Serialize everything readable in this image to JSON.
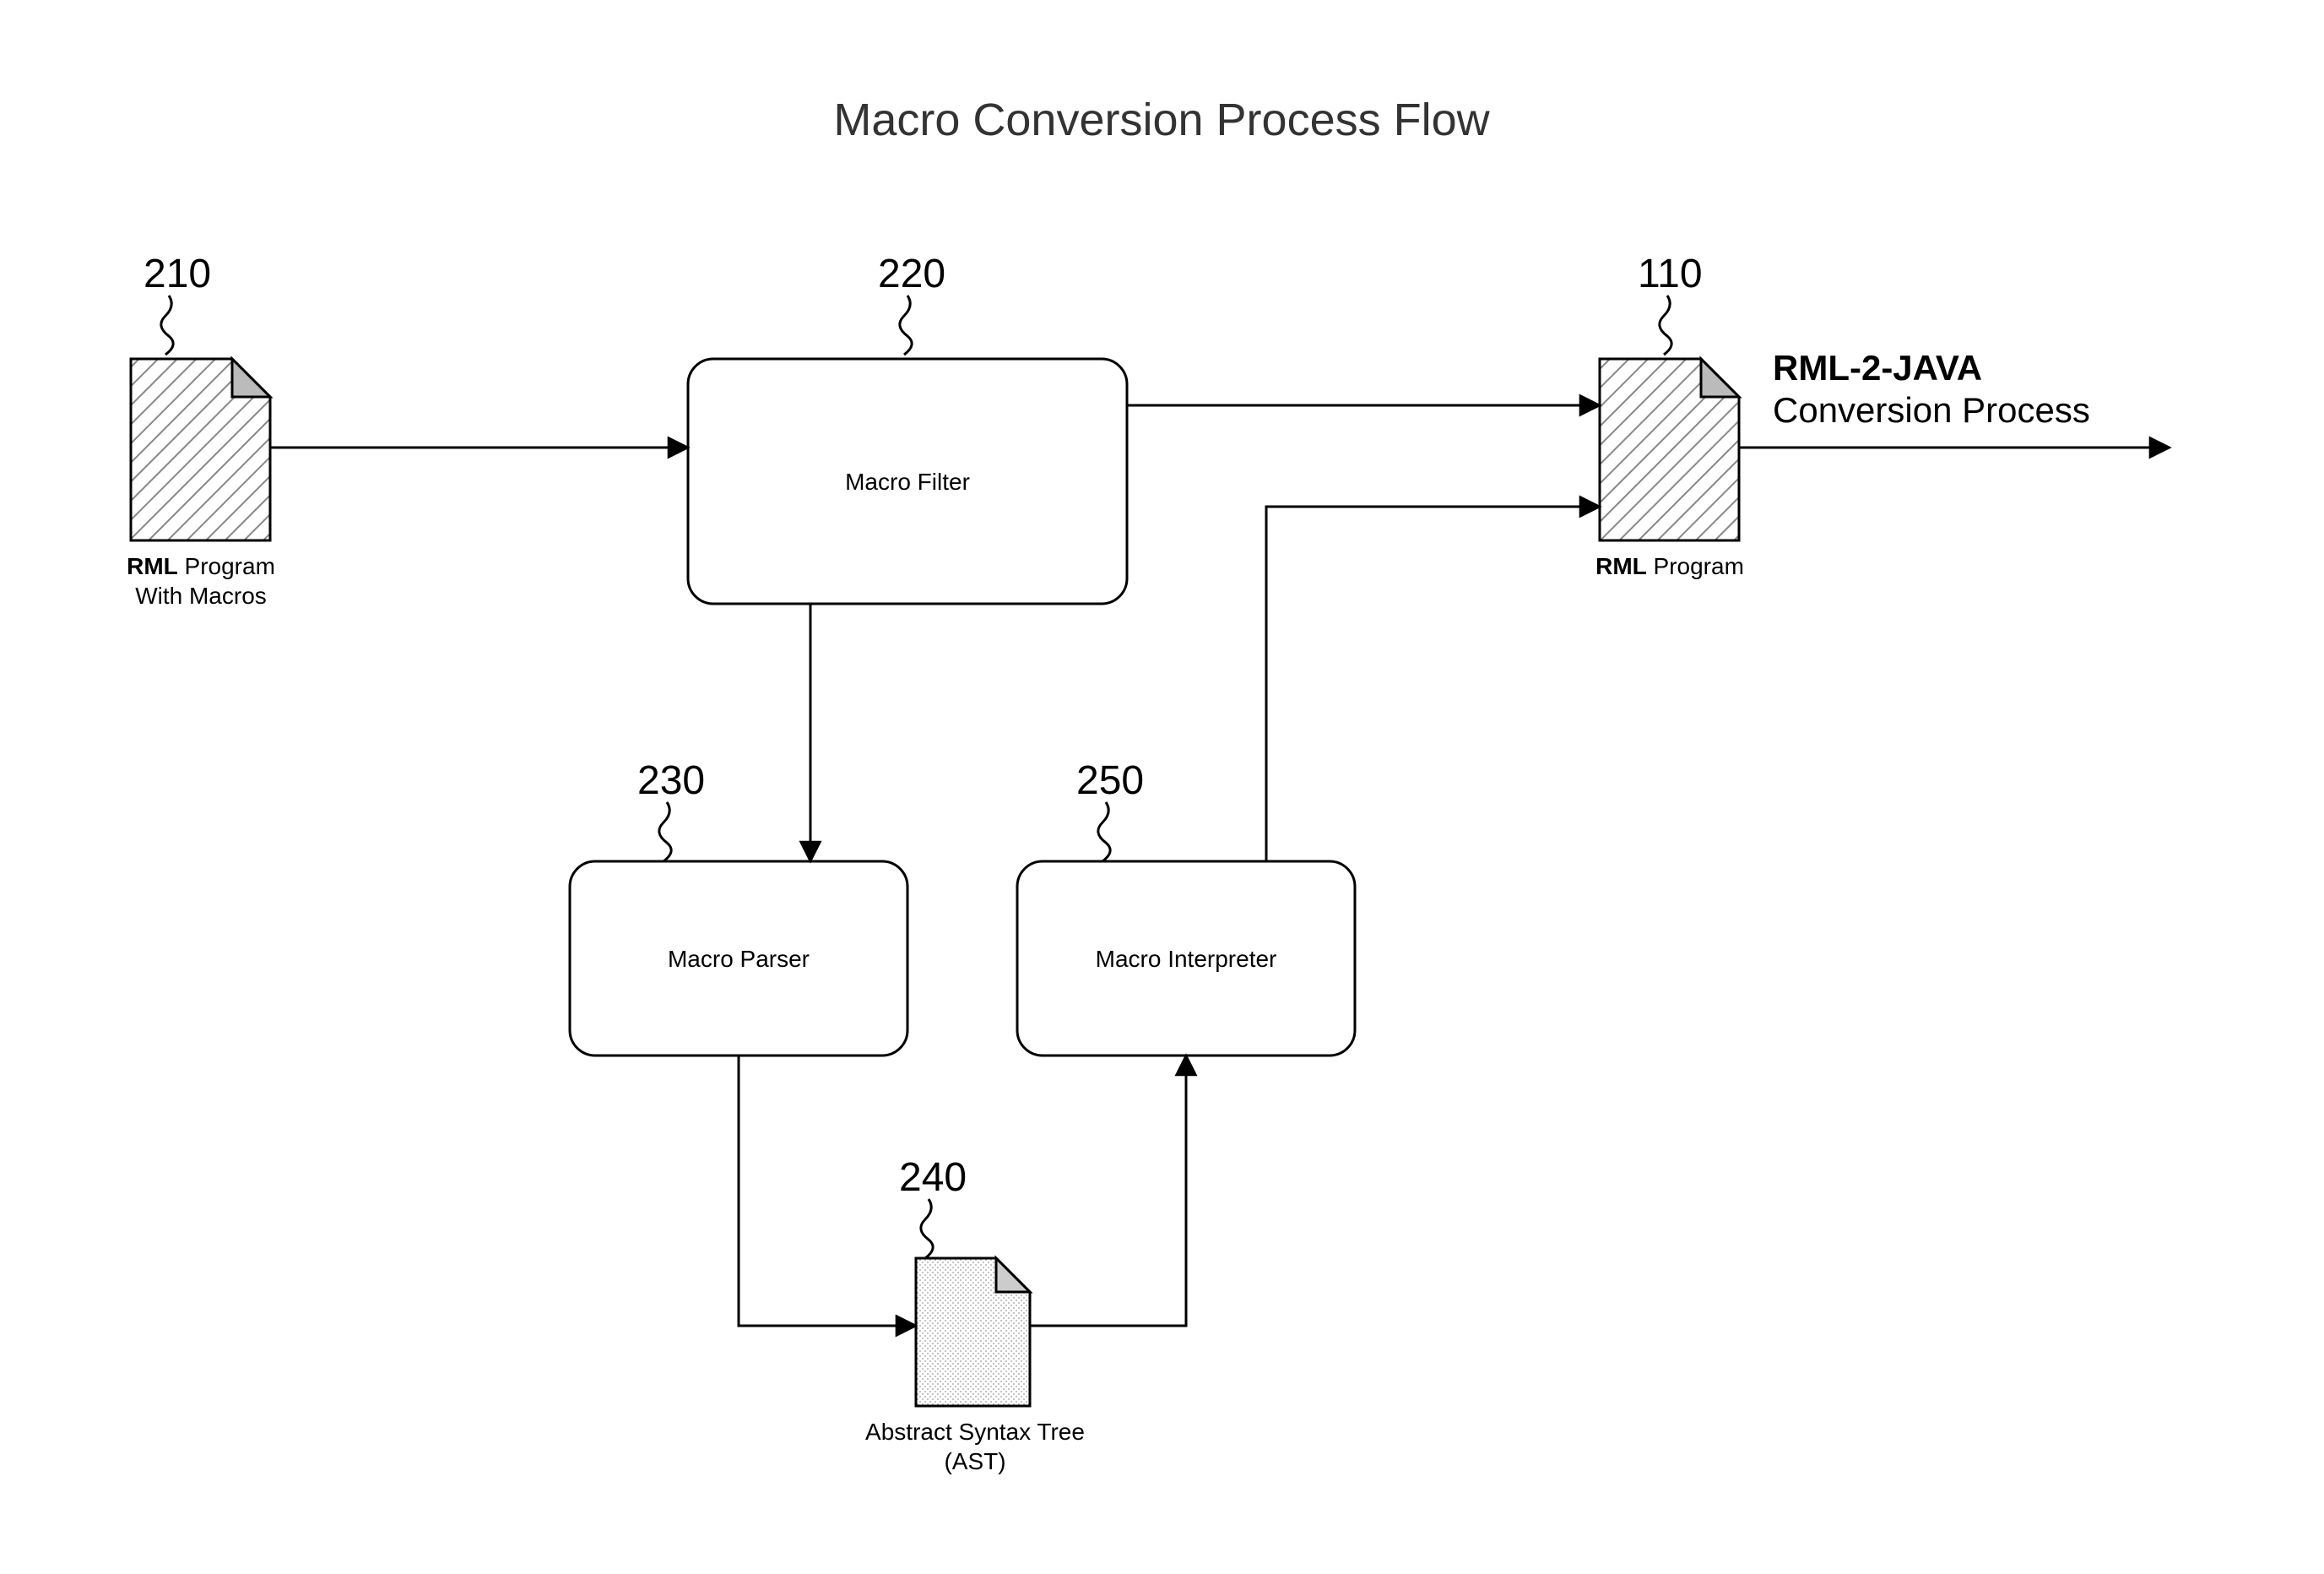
{
  "title": "Macro Conversion Process Flow",
  "refs": {
    "r210": "210",
    "r220": "220",
    "r230": "230",
    "r240": "240",
    "r250": "250",
    "r110": "110"
  },
  "boxes": {
    "filter": "Macro Filter",
    "parser": "Macro Parser",
    "interpreter": "Macro Interpreter"
  },
  "docs": {
    "input_bold": "RML",
    "input_rest": " Program",
    "input_line2": "With Macros",
    "ast_line1": "Abstract Syntax Tree",
    "ast_line2": "(AST)",
    "output_bold": "RML",
    "output_rest": " Program"
  },
  "out": {
    "line1": "RML-2-JAVA",
    "line2": "Conversion Process"
  }
}
